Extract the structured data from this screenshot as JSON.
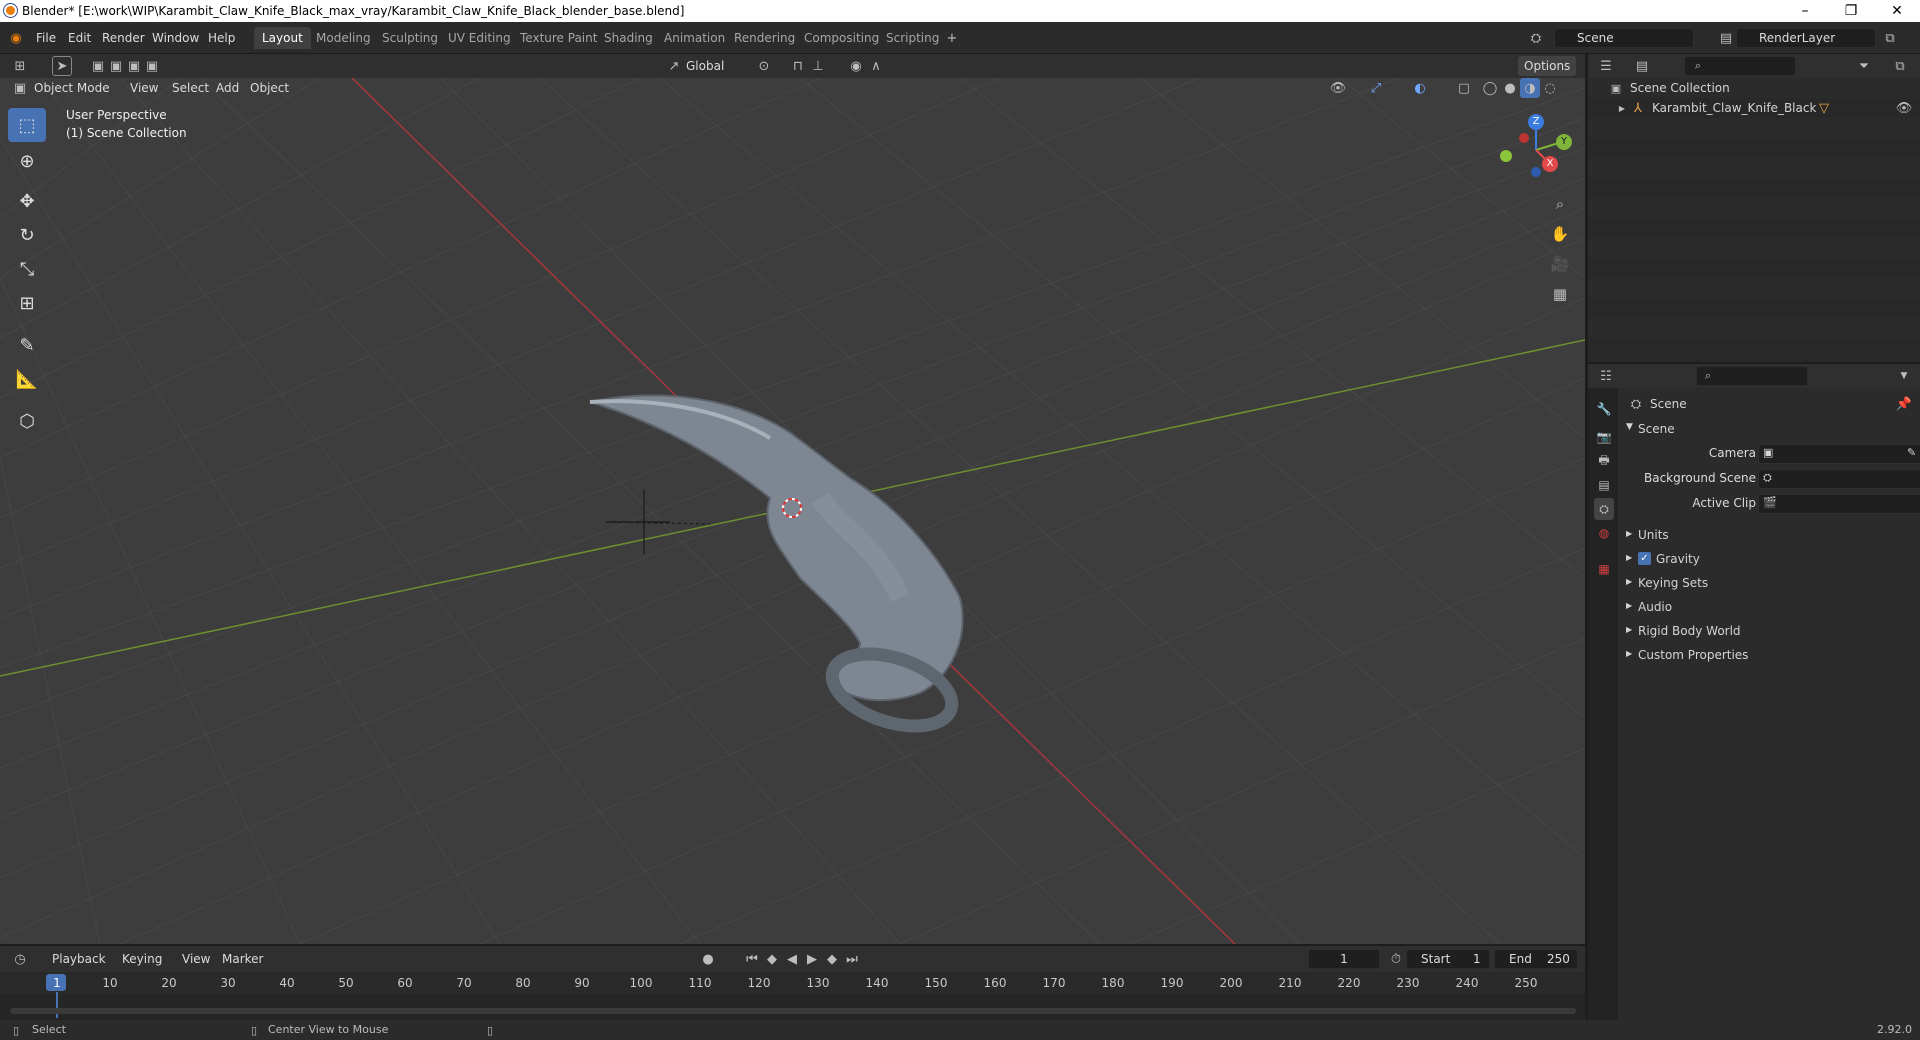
{
  "window": {
    "title": "Blender* [E:\\work\\WIP\\Karambit_Claw_Knife_Black_max_vray/Karambit_Claw_Knife_Black_blender_base.blend]",
    "minimize": "–",
    "restore": "❐",
    "close": "✕"
  },
  "menu": [
    "File",
    "Edit",
    "Render",
    "Window",
    "Help"
  ],
  "workspaces": [
    "Layout",
    "Modeling",
    "Sculpting",
    "UV Editing",
    "Texture Paint",
    "Shading",
    "Animation",
    "Rendering",
    "Compositing",
    "Scripting"
  ],
  "active_workspace": "Layout",
  "scene_field": "Scene",
  "renderlayer_field": "RenderLayer",
  "toolbar_header": {
    "transform_orientation": "Global",
    "options": "Options"
  },
  "viewport_header": {
    "mode": "Object Mode",
    "menus": [
      "View",
      "Select",
      "Add",
      "Object"
    ]
  },
  "viewport": {
    "overlay_line1": "User Perspective",
    "overlay_line2": "(1) Scene Collection",
    "gizmo": {
      "x": "X",
      "y": "Y",
      "z": "Z"
    }
  },
  "outliner": {
    "root": "Scene Collection",
    "items": [
      {
        "label": "Karambit_Claw_Knife_Black"
      }
    ]
  },
  "properties": {
    "context": "Scene",
    "panel": "Scene",
    "fields": [
      {
        "label": "Camera"
      },
      {
        "label": "Background Scene"
      },
      {
        "label": "Active Clip"
      }
    ],
    "sections": [
      "Units",
      "Gravity",
      "Keying Sets",
      "Audio",
      "Rigid Body World",
      "Custom Properties"
    ],
    "gravity_checked": true
  },
  "timeline": {
    "menus": [
      "Playback",
      "Keying",
      "View",
      "Marker"
    ],
    "current_frame": "1",
    "start_label": "Start",
    "start": "1",
    "end_label": "End",
    "end": "250",
    "ticks": [
      "1",
      "10",
      "20",
      "30",
      "40",
      "50",
      "60",
      "70",
      "80",
      "90",
      "100",
      "110",
      "120",
      "130",
      "140",
      "150",
      "160",
      "170",
      "180",
      "190",
      "200",
      "210",
      "220",
      "230",
      "240",
      "250"
    ]
  },
  "statusbar": {
    "left": "Select",
    "middle": "Center View to Mouse",
    "version": "2.92.0"
  }
}
